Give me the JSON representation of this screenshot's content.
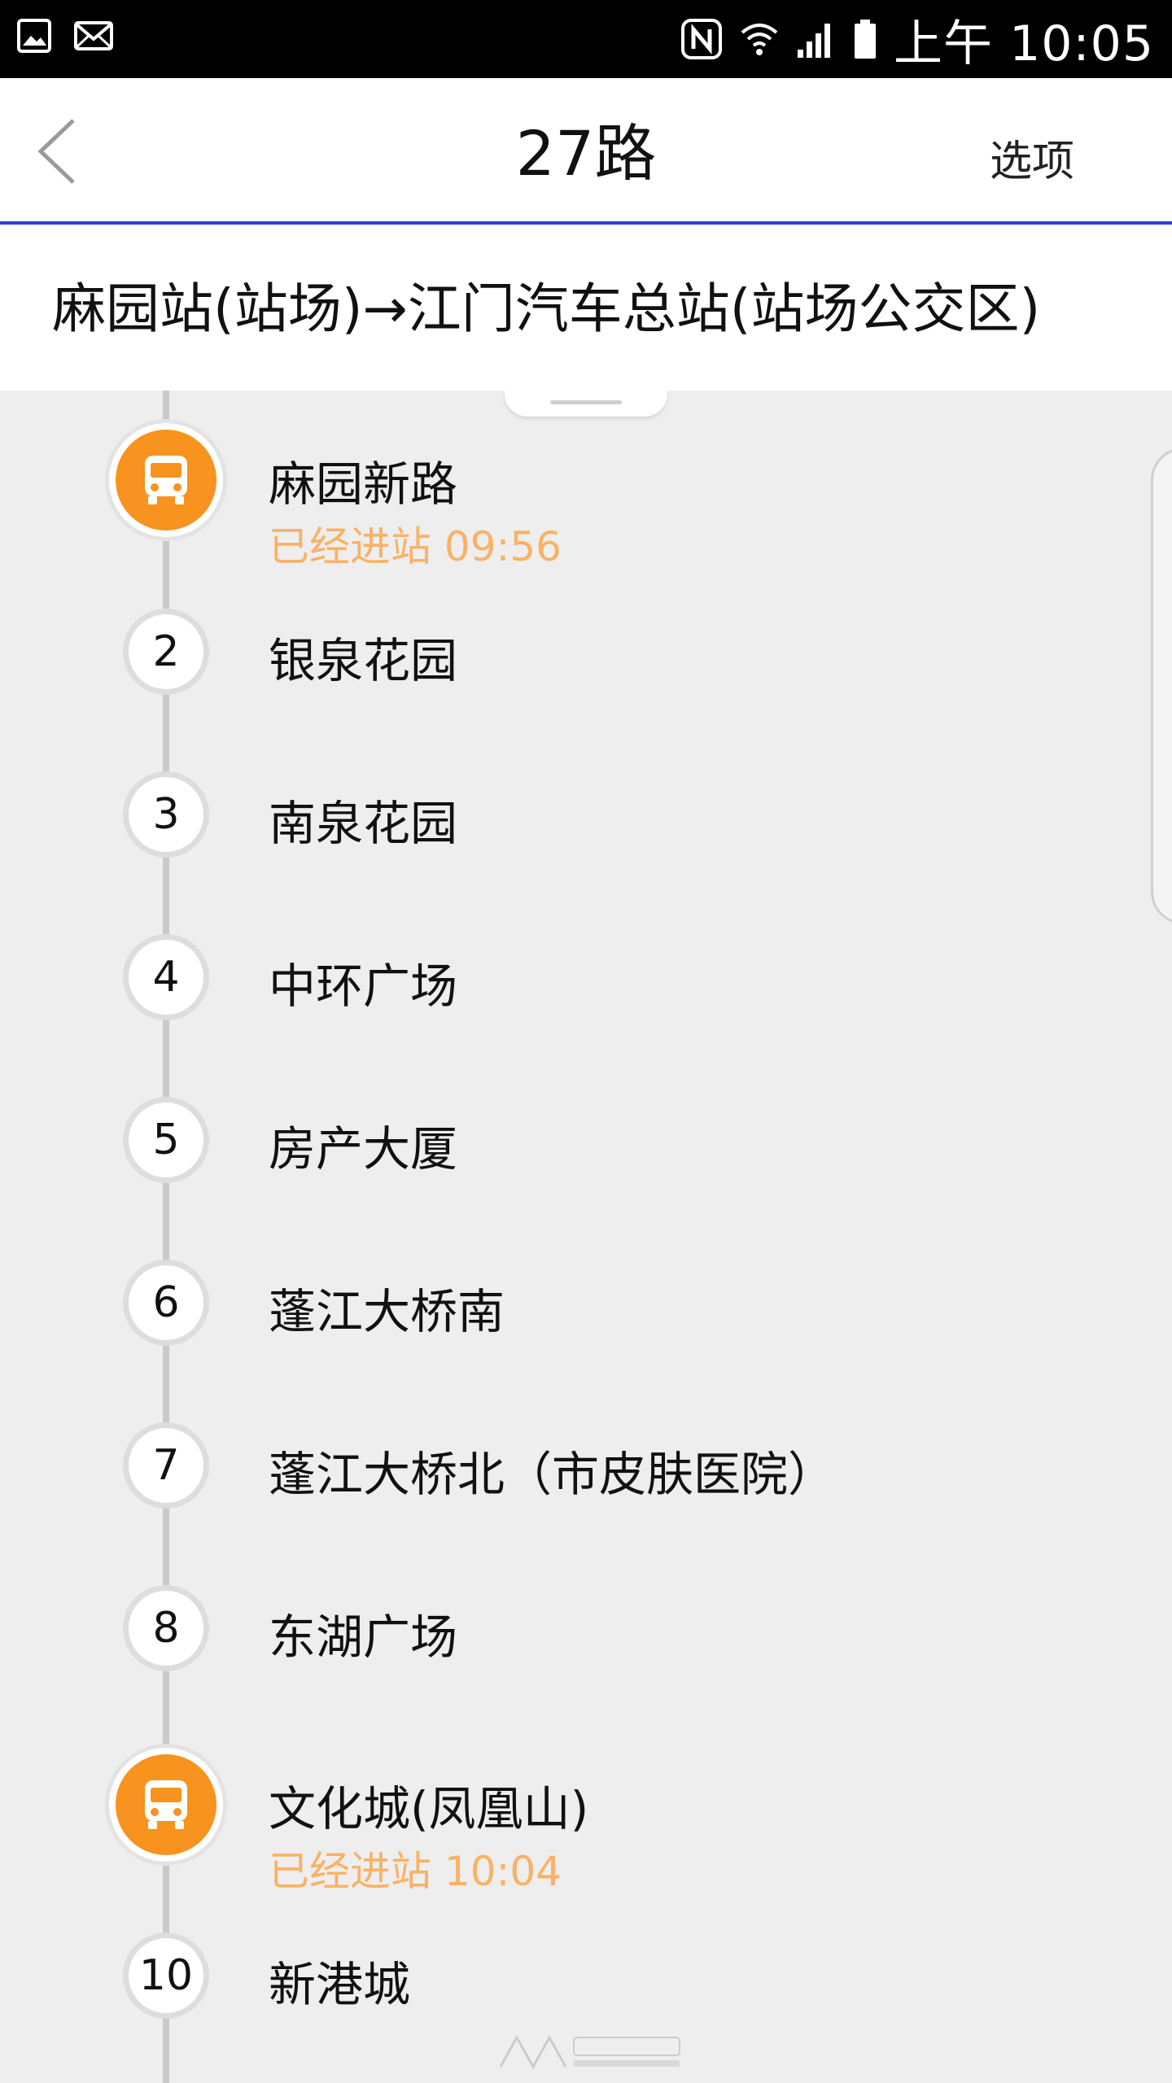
{
  "status_bar": {
    "time": "上午 10:05",
    "icons": [
      "image-icon",
      "mail-icon",
      "nfc-icon",
      "wifi-icon",
      "signal-icon",
      "battery-icon"
    ]
  },
  "appbar": {
    "title": "27路",
    "options_label": "选项"
  },
  "route": {
    "direction": "麻园站(站场)→江门汽车总站(站场公交区)"
  },
  "stops": [
    {
      "index": "",
      "name": "麻园新路",
      "status": "已经进站 09:56",
      "bus": true
    },
    {
      "index": "2",
      "name": "银泉花园",
      "status": "",
      "bus": false
    },
    {
      "index": "3",
      "name": "南泉花园",
      "status": "",
      "bus": false
    },
    {
      "index": "4",
      "name": "中环广场",
      "status": "",
      "bus": false
    },
    {
      "index": "5",
      "name": "房产大厦",
      "status": "",
      "bus": false
    },
    {
      "index": "6",
      "name": "蓬江大桥南",
      "status": "",
      "bus": false
    },
    {
      "index": "7",
      "name": "蓬江大桥北（市皮肤医院）",
      "status": "",
      "bus": false
    },
    {
      "index": "8",
      "name": "东湖广场",
      "status": "",
      "bus": false
    },
    {
      "index": "",
      "name": "文化城(凤凰山)",
      "status": "已经进站 10:04",
      "bus": true
    },
    {
      "index": "10",
      "name": "新港城",
      "status": "",
      "bus": false
    }
  ],
  "colors": {
    "accent_orange": "#f7931e",
    "status_text": "#f9b266",
    "appbar_divider": "#2f3fd6"
  }
}
